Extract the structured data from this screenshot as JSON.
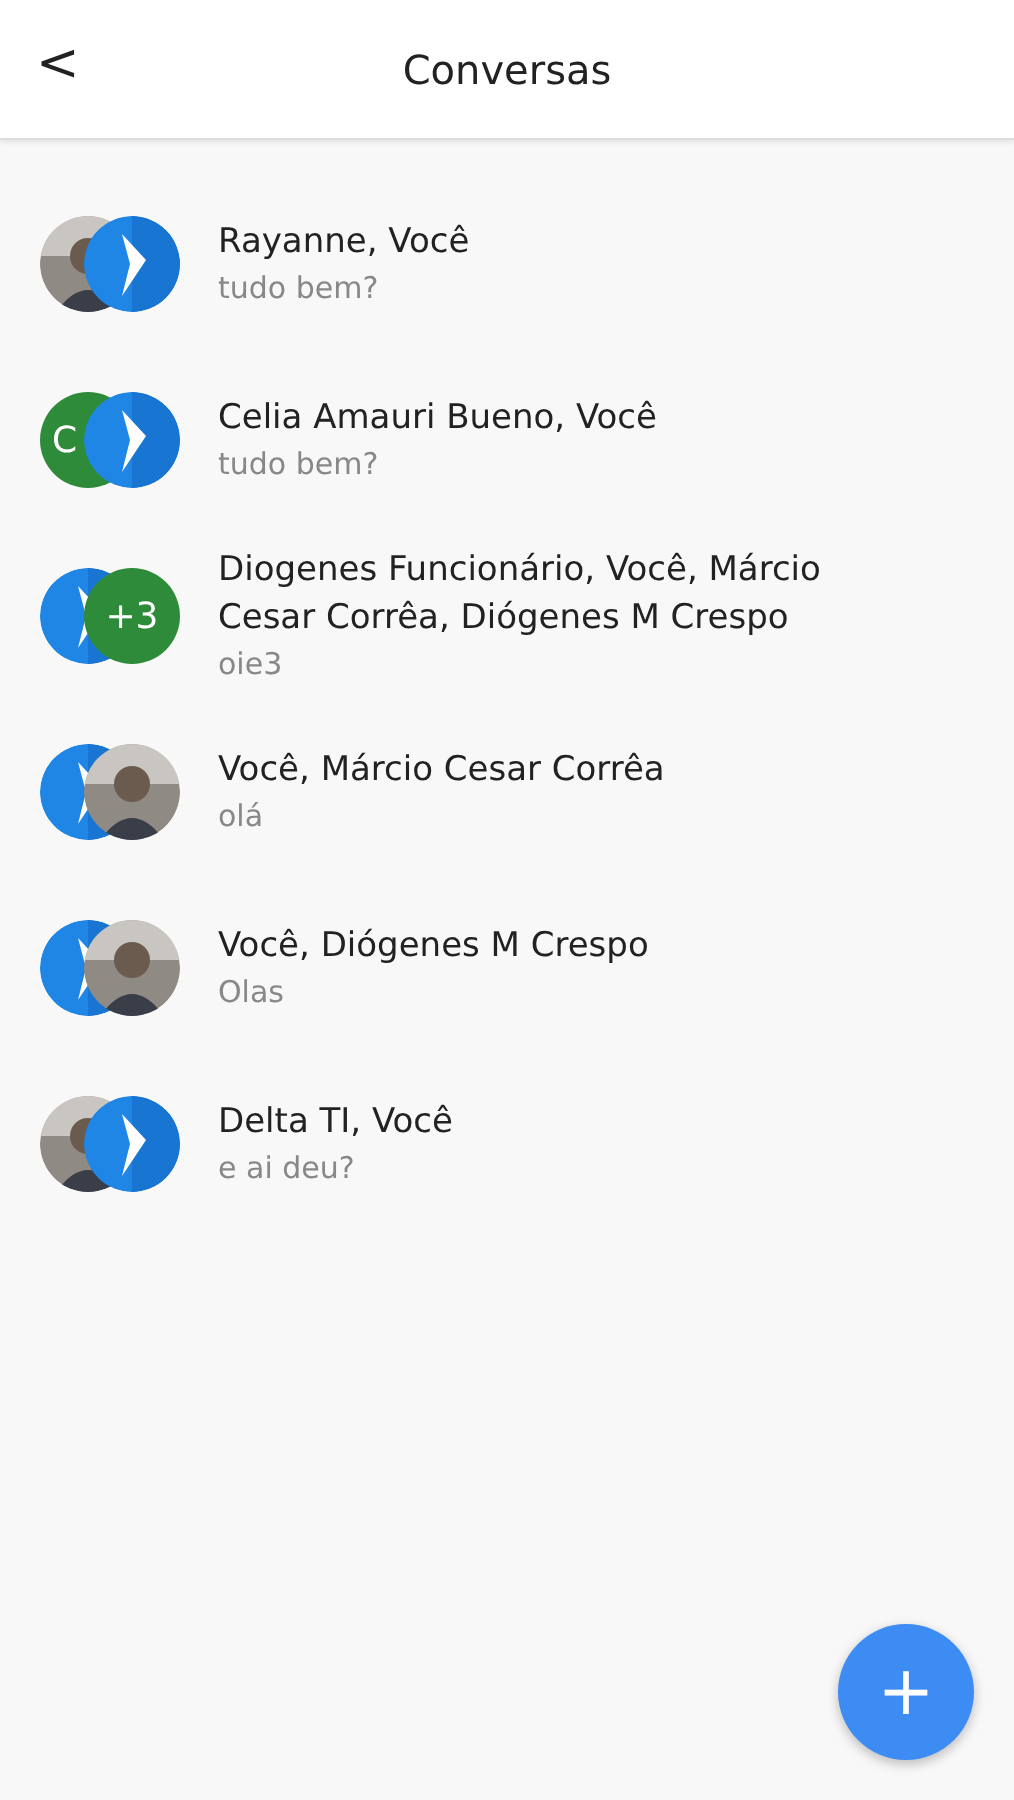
{
  "header": {
    "back": "<",
    "title": "Conversas"
  },
  "conversations": [
    {
      "title": "Rayanne, Você",
      "preview": "tudo bem?",
      "avatars": [
        {
          "kind": "picture"
        },
        {
          "kind": "logo"
        }
      ]
    },
    {
      "title": "Celia Amauri Bueno, Você",
      "preview": "tudo bem?",
      "avatars": [
        {
          "kind": "initial",
          "text": "C"
        },
        {
          "kind": "logo"
        }
      ]
    },
    {
      "title": "Diogenes Funcionário, Você, Márcio Cesar Corrêa, Diógenes M Crespo",
      "preview": "oie3",
      "avatars": [
        {
          "kind": "logo"
        },
        {
          "kind": "count",
          "text": "+3"
        }
      ]
    },
    {
      "title": "Você, Márcio Cesar Corrêa",
      "preview": "olá",
      "avatars": [
        {
          "kind": "logo"
        },
        {
          "kind": "picture"
        }
      ]
    },
    {
      "title": "Você, Diógenes M Crespo",
      "preview": "Olas",
      "avatars": [
        {
          "kind": "logo"
        },
        {
          "kind": "picture"
        }
      ]
    },
    {
      "title": "Delta TI, Você",
      "preview": "e ai deu?",
      "avatars": [
        {
          "kind": "picture"
        },
        {
          "kind": "logo"
        }
      ]
    }
  ],
  "fab": {
    "label": "+"
  }
}
